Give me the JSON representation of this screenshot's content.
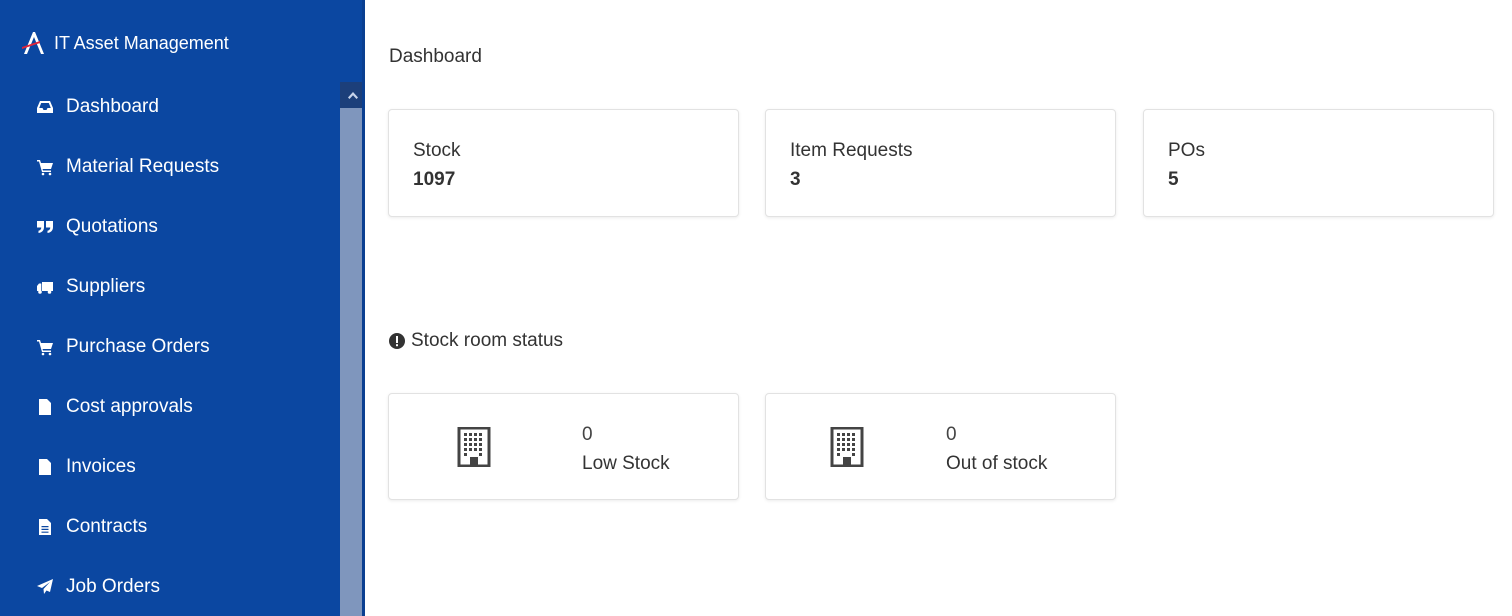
{
  "app": {
    "title": "IT Asset Management"
  },
  "sidebar": {
    "items": [
      {
        "label": "Dashboard",
        "icon": "inbox-icon"
      },
      {
        "label": "Material Requests",
        "icon": "cart-icon"
      },
      {
        "label": "Quotations",
        "icon": "quote-icon"
      },
      {
        "label": "Suppliers",
        "icon": "truck-icon"
      },
      {
        "label": "Purchase Orders",
        "icon": "cart-icon"
      },
      {
        "label": "Cost approvals",
        "icon": "file-icon"
      },
      {
        "label": "Invoices",
        "icon": "file-icon"
      },
      {
        "label": "Contracts",
        "icon": "file-text-icon"
      },
      {
        "label": "Job Orders",
        "icon": "paper-plane-icon"
      }
    ]
  },
  "main": {
    "title": "Dashboard",
    "stats": [
      {
        "label": "Stock",
        "value": "1097"
      },
      {
        "label": "Item Requests",
        "value": "3"
      },
      {
        "label": "POs",
        "value": "5"
      }
    ],
    "stock_section": {
      "title": "Stock room status",
      "icon": "exclamation-circle-icon",
      "cards": [
        {
          "value": "0",
          "label": "Low Stock",
          "icon": "building-icon"
        },
        {
          "value": "0",
          "label": "Out of stock",
          "icon": "building-icon"
        }
      ]
    }
  },
  "colors": {
    "sidebar": "#0b47a1",
    "scrollbar": "#7f96bd",
    "text": "#333333"
  }
}
